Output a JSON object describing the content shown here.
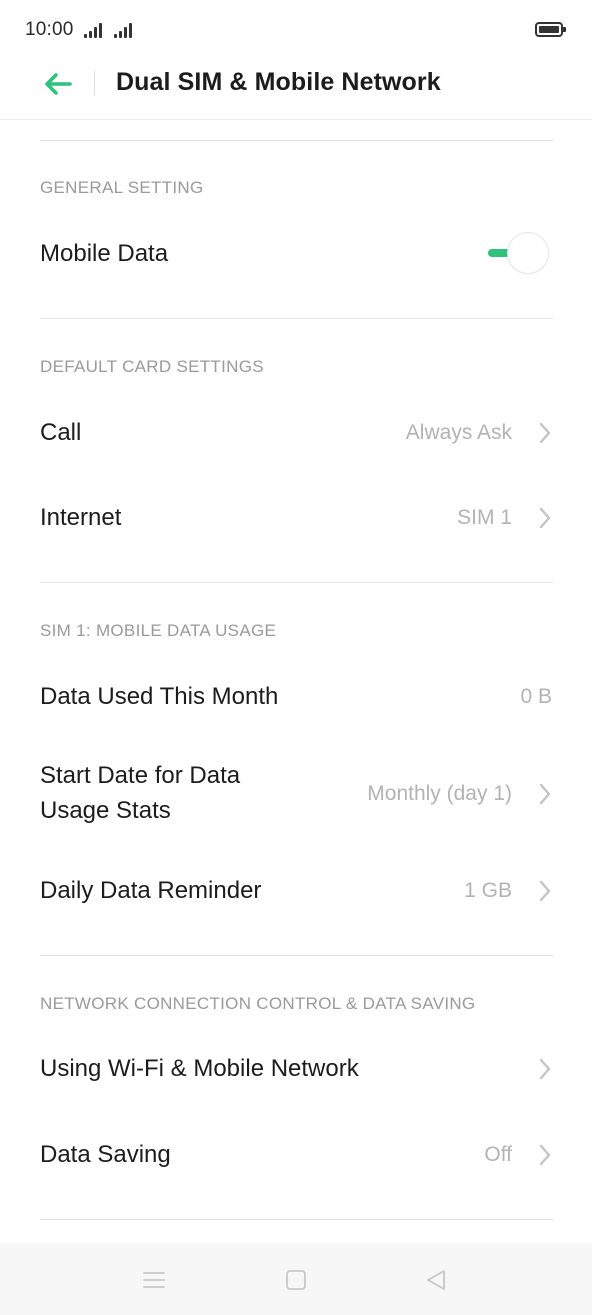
{
  "status_bar": {
    "time": "10:00"
  },
  "header": {
    "title": "Dual SIM & Mobile Network",
    "back_icon": "arrow-left-icon",
    "accent_color": "#2ec27e"
  },
  "general_setting": {
    "header": "GENERAL SETTING",
    "mobile_data": {
      "label": "Mobile Data",
      "enabled": true
    }
  },
  "default_card_settings": {
    "header": "DEFAULT CARD SETTINGS",
    "call": {
      "label": "Call",
      "value": "Always Ask"
    },
    "internet": {
      "label": "Internet",
      "value": "SIM 1"
    }
  },
  "data_usage": {
    "header": "SIM 1: MOBILE DATA USAGE",
    "used": {
      "label": "Data Used This Month",
      "value": "0 B"
    },
    "start_date": {
      "label_line1": "Start Date for Data",
      "label_line2": "Usage Stats",
      "value": "Monthly (day 1)"
    },
    "reminder": {
      "label": "Daily Data Reminder",
      "value": "1 GB"
    }
  },
  "network_control": {
    "header": "NETWORK CONNECTION CONTROL & DATA SAVING",
    "wifi_mobile": {
      "label": "Using Wi-Fi & Mobile Network"
    },
    "data_saving": {
      "label": "Data Saving",
      "value": "Off"
    }
  },
  "nav_bar": {
    "icons": [
      "menu-icon",
      "home-icon",
      "back-triangle-icon"
    ]
  }
}
